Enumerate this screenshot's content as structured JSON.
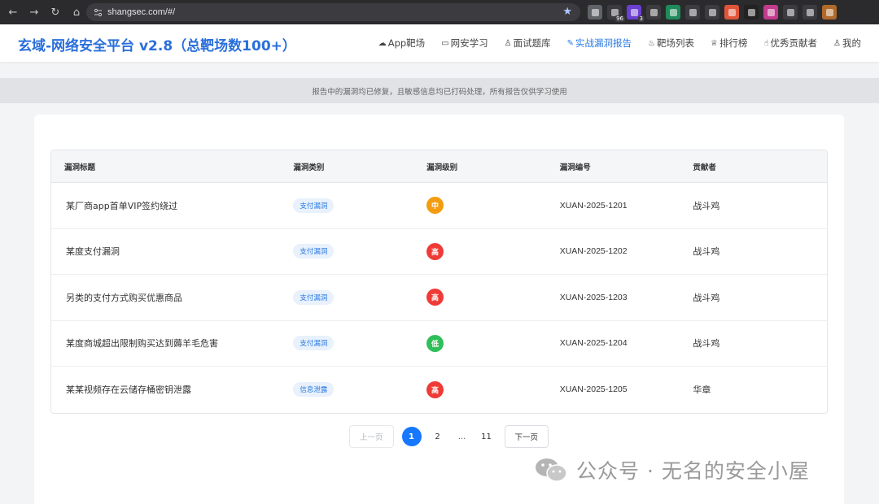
{
  "browser": {
    "url": "shangsec.com/#/",
    "extensions": [
      {
        "icon": "record-icon",
        "color": "#5f6368",
        "badge": ""
      },
      {
        "icon": "ext-96-icon",
        "color": "#3c3c40",
        "badge": "96"
      },
      {
        "icon": "ext-3-icon",
        "color": "#6a3fd1",
        "badge": "3"
      },
      {
        "icon": "trash-icon",
        "color": "#3c3c40",
        "badge": ""
      },
      {
        "icon": "ext-green-icon",
        "color": "#1f8a5a",
        "badge": ""
      },
      {
        "icon": "doc-icon",
        "color": "#3c3c40",
        "badge": ""
      },
      {
        "icon": "ext-color-icon",
        "color": "#3c3c40",
        "badge": ""
      },
      {
        "icon": "ext-orange-icon",
        "color": "#e0553a",
        "badge": ""
      },
      {
        "icon": "ext-text-icon",
        "color": "#222",
        "badge": ""
      },
      {
        "icon": "ext-pink-icon",
        "color": "#c23b8c",
        "badge": ""
      },
      {
        "icon": "puzzle-icon",
        "color": "#3c3c40",
        "badge": ""
      },
      {
        "icon": "grid-icon",
        "color": "#3c3c40",
        "badge": ""
      },
      {
        "icon": "avatar-icon",
        "color": "#b06a2a",
        "badge": ""
      }
    ]
  },
  "header": {
    "brand": "玄域-网络安全平台 v2.8（总靶场数100+）",
    "nav": [
      {
        "icon": "cloud-icon",
        "glyph": "☁",
        "label": "App靶场",
        "active": false
      },
      {
        "icon": "monitor-icon",
        "glyph": "▭",
        "label": "网安学习",
        "active": false
      },
      {
        "icon": "user-icon",
        "glyph": "♙",
        "label": "面试题库",
        "active": false
      },
      {
        "icon": "edit-icon",
        "glyph": "✎",
        "label": "实战漏洞报告",
        "active": true
      },
      {
        "icon": "fire-icon",
        "glyph": "♨",
        "label": "靶场列表",
        "active": false
      },
      {
        "icon": "trophy-icon",
        "glyph": "♕",
        "label": "排行榜",
        "active": false
      },
      {
        "icon": "thumbs-up-icon",
        "glyph": "☝",
        "label": "优秀贡献者",
        "active": false
      },
      {
        "icon": "person-icon",
        "glyph": "♙",
        "label": "我的",
        "active": false
      }
    ]
  },
  "notice": "报告中的漏洞均已修复，且敏感信息均已打码处理，所有报告仅供学习使用",
  "table": {
    "headers": [
      "漏洞标题",
      "漏洞类别",
      "漏洞级别",
      "漏洞编号",
      "贡献者"
    ],
    "rows": [
      {
        "title": "某厂商app首单VIP签约绕过",
        "category": "支付漏洞",
        "level": "中",
        "level_color": "#f39c12",
        "id": "XUAN-2025-1201",
        "contributor": "战斗鸡"
      },
      {
        "title": "某度支付漏洞",
        "category": "支付漏洞",
        "level": "高",
        "level_color": "#ef3b36",
        "id": "XUAN-2025-1202",
        "contributor": "战斗鸡"
      },
      {
        "title": "另类的支付方式购买优惠商品",
        "category": "支付漏洞",
        "level": "高",
        "level_color": "#ef3b36",
        "id": "XUAN-2025-1203",
        "contributor": "战斗鸡"
      },
      {
        "title": "某度商城超出限制购买达到薅羊毛危害",
        "category": "支付漏洞",
        "level": "低",
        "level_color": "#2fbf5a",
        "id": "XUAN-2025-1204",
        "contributor": "战斗鸡"
      },
      {
        "title": "某某视频存在云储存桶密钥泄露",
        "category": "信息泄露",
        "level": "高",
        "level_color": "#ef3b36",
        "id": "XUAN-2025-1205",
        "contributor": "华章"
      }
    ]
  },
  "pagination": {
    "prev": "上一页",
    "next": "下一页",
    "pages": [
      "1",
      "2"
    ],
    "ellipsis": "...",
    "last": "11",
    "current": "1"
  },
  "watermark": "公众号 · 无名的安全小屋"
}
